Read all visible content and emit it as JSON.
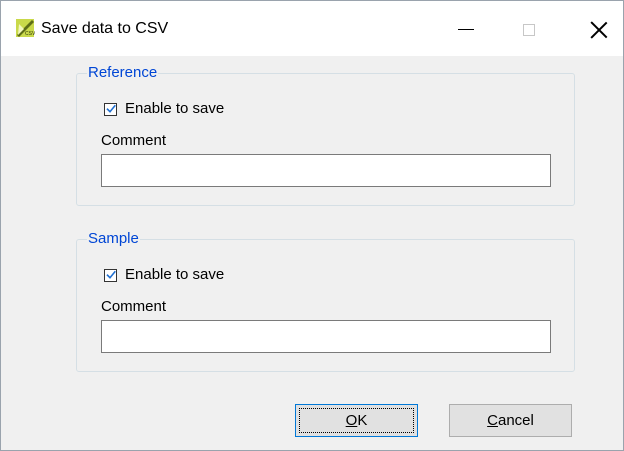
{
  "window": {
    "title": "Save data to CSV",
    "controls": {
      "minimize": "minimize-icon",
      "maximize": "maximize-icon",
      "close": "close-icon"
    },
    "app_icon": "csv-export-icon"
  },
  "groups": {
    "reference": {
      "title": "Reference",
      "checkbox": {
        "label": "Enable to save",
        "checked": true
      },
      "comment": {
        "label": "Comment",
        "value": "",
        "placeholder": ""
      }
    },
    "sample": {
      "title": "Sample",
      "checkbox": {
        "label": "Enable to save",
        "checked": true
      },
      "comment": {
        "label": "Comment",
        "value": "",
        "placeholder": ""
      }
    }
  },
  "buttons": {
    "ok": {
      "mnemonic": "O",
      "rest": "K"
    },
    "cancel": {
      "mnemonic": "C",
      "rest": "ancel"
    }
  },
  "colors": {
    "group_title": "#0046d5",
    "checkbox_check": "#1f6fd1",
    "focus_border": "#0078d7",
    "dialog_background": "#f0f0f0"
  }
}
